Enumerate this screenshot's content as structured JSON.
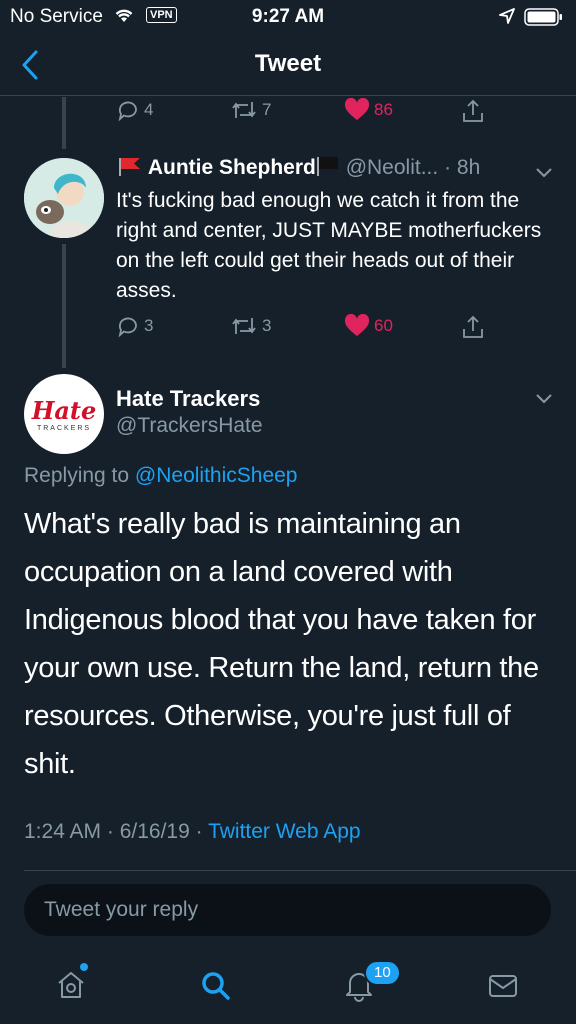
{
  "status_bar": {
    "carrier": "No Service",
    "vpn": "VPN",
    "time": "9:27 AM"
  },
  "nav": {
    "title": "Tweet"
  },
  "prev_actions": {
    "replies": "4",
    "retweets": "7",
    "likes": "86"
  },
  "mid_tweet": {
    "name": "Auntie Shepherd",
    "handle": "@Neolit...",
    "time": "· 8h",
    "text": "It's fucking bad enough we catch it from the right and center, JUST MAYBE motherfuckers on the left could get their heads out of their asses.",
    "replies": "3",
    "retweets": "3",
    "likes": "60"
  },
  "main_tweet": {
    "avatar_logo": "Hate",
    "avatar_sub": "TRACKERS",
    "name": "Hate Trackers",
    "handle": "@TrackersHate",
    "replying_prefix": "Replying to ",
    "replying_mention": "@NeolithicSheep",
    "text": "What's really bad is maintaining an occupation on a land covered with Indigenous blood that you have taken for your own use. Return the land, return the resources. Otherwise, you're just full of shit.",
    "timestamp": "1:24 AM · 6/16/19 · ",
    "source_app": "Twitter Web App"
  },
  "reply": {
    "placeholder": "Tweet your reply"
  },
  "tabbar": {
    "notification_count": "10"
  },
  "colors": {
    "background": "#15202b",
    "accent": "#1da1f2",
    "like": "#e0245e",
    "muted": "#8899a6"
  }
}
